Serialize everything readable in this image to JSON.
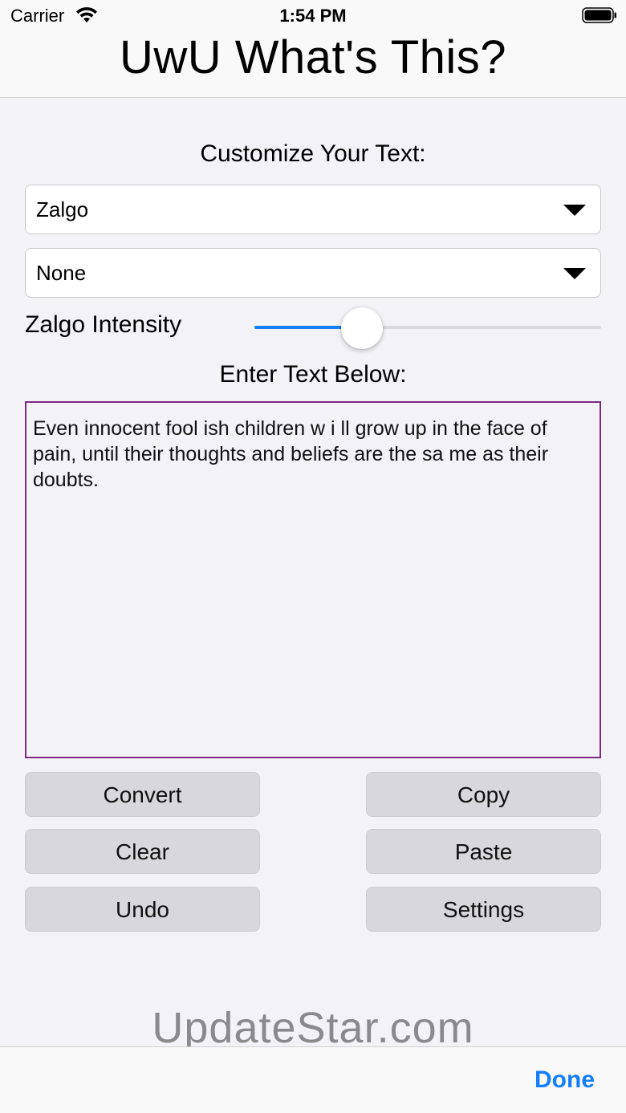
{
  "status_bar": {
    "carrier": "Carrier",
    "time": "1:54 PM"
  },
  "header": {
    "title": "UwU What's This?"
  },
  "customize": {
    "label": "Customize Your Text:"
  },
  "dropdowns": [
    {
      "value": "Zalgo"
    },
    {
      "value": "None"
    }
  ],
  "slider": {
    "label": "Zalgo Intensity",
    "value": 0.31,
    "accent": "#147efb"
  },
  "input": {
    "label": "Enter Text Below:",
    "text": "Even innocent fool ish children w i ll grow up in the face of pain, until their thoughts and beliefs are the sa me as their doubts."
  },
  "buttons": {
    "convert": "Convert",
    "copy": "Copy",
    "clear": "Clear",
    "paste": "Paste",
    "undo": "Undo",
    "settings": "Settings"
  },
  "watermark": "UpdateStar.com",
  "bottom_bar": {
    "done": "Done"
  },
  "colors": {
    "accent": "#147efb",
    "text_area_border": "#7e2a84",
    "button_bg": "#d8d8dc"
  }
}
